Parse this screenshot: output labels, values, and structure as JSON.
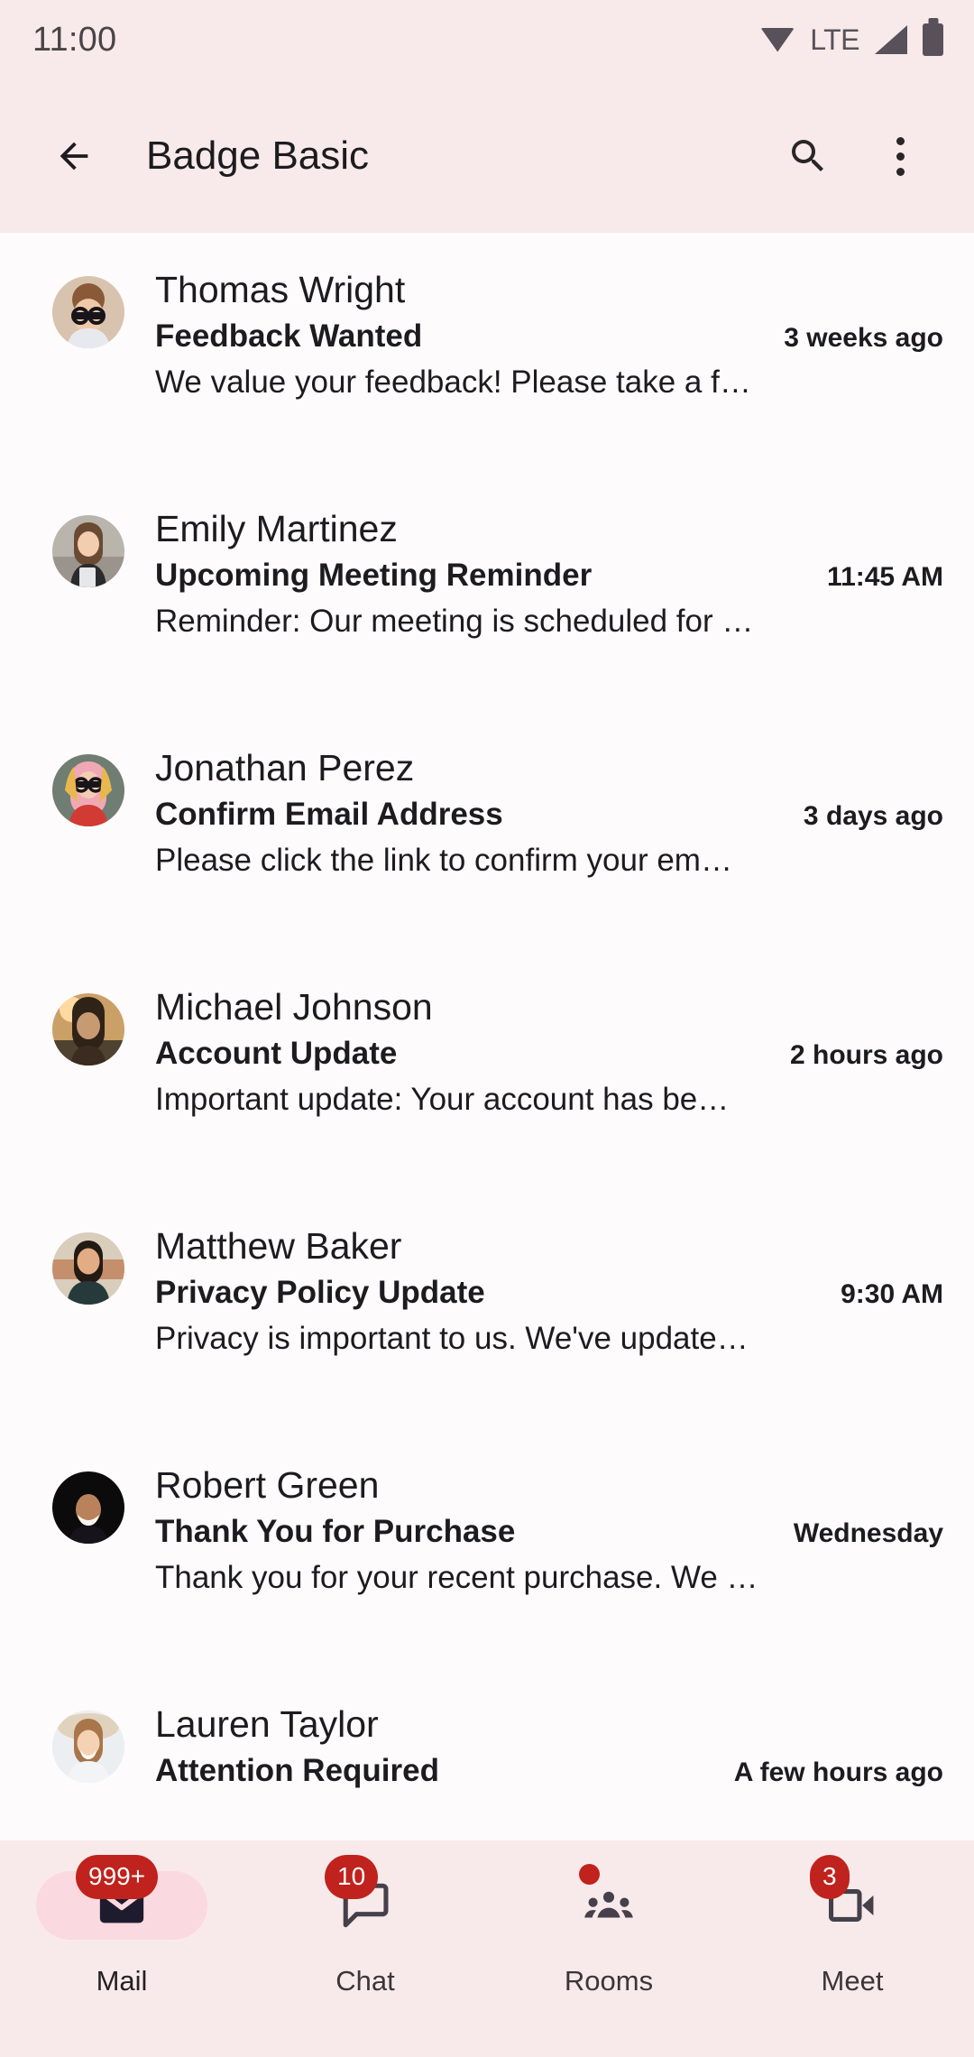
{
  "statusbar": {
    "clock": "11:00",
    "network_label": "LTE",
    "icons": [
      "wifi-icon",
      "lte-label",
      "cellular-signal-icon",
      "battery-icon"
    ]
  },
  "appbar": {
    "title": "Badge Basic",
    "back_icon": "back-arrow-icon",
    "search_icon": "search-icon",
    "overflow_icon": "more-vertical-icon"
  },
  "mail_list": [
    {
      "sender": "Thomas Wright",
      "subject": "Feedback Wanted",
      "time": "3 weeks ago",
      "snippet": "We value your feedback! Please take a f…"
    },
    {
      "sender": "Emily Martinez",
      "subject": "Upcoming Meeting Reminder",
      "time": "11:45 AM",
      "snippet": "Reminder: Our meeting is scheduled for …"
    },
    {
      "sender": "Jonathan Perez",
      "subject": "Confirm Email Address",
      "time": "3 days ago",
      "snippet": "Please click the link to confirm your em…"
    },
    {
      "sender": "Michael Johnson",
      "subject": "Account Update",
      "time": "2 hours ago",
      "snippet": "Important update: Your account has be…"
    },
    {
      "sender": "Matthew Baker",
      "subject": "Privacy Policy Update",
      "time": "9:30 AM",
      "snippet": "Privacy is important to us. We've update…"
    },
    {
      "sender": "Robert Green",
      "subject": "Thank You for Purchase",
      "time": "Wednesday",
      "snippet": "Thank you for your recent purchase. We …"
    },
    {
      "sender": "Lauren Taylor",
      "subject": "Attention Required",
      "time": "A few hours ago",
      "snippet": ""
    }
  ],
  "bottom_nav": [
    {
      "label": "Mail",
      "icon": "mail-icon",
      "badge": "999+",
      "badge_type": "count",
      "selected": true
    },
    {
      "label": "Chat",
      "icon": "chat-icon",
      "badge": "10",
      "badge_type": "count",
      "selected": false
    },
    {
      "label": "Rooms",
      "icon": "people-icon",
      "badge": "",
      "badge_type": "dot",
      "selected": false
    },
    {
      "label": "Meet",
      "icon": "video-icon",
      "badge": "3",
      "badge_type": "count",
      "selected": false
    }
  ],
  "colors": {
    "appbar_bg": "#f8eaea",
    "list_bg": "#fdfbfb",
    "badge_red": "#c0221d",
    "nav_pill": "#fbd9e0",
    "text_primary": "#1c1b1f"
  }
}
